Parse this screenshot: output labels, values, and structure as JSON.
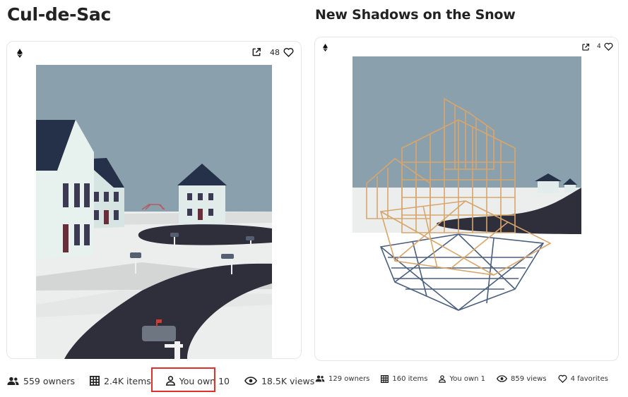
{
  "items": [
    {
      "title": "Cul-de-Sac",
      "favorites_count": "48",
      "artwork": "cul-de-sac-house-scene",
      "stats": {
        "owners": "559 owners",
        "items": "2.4K items",
        "you_own": "You own 10",
        "views": "18.5K views"
      }
    },
    {
      "title": "New Shadows on the Snow",
      "favorites_count": "4",
      "artwork": "wireframe-houses-scene",
      "stats": {
        "owners": "129 owners",
        "items": "160 items",
        "you_own": "You own 1",
        "views": "859 views",
        "favorites": "4 favorites"
      }
    }
  ],
  "icons": {
    "chain": "ethereum-icon",
    "open": "external-link-icon",
    "favorite": "heart-icon",
    "owners": "people-icon",
    "items": "grid-icon",
    "you_own": "person-icon",
    "views": "eye-icon",
    "favorites": "heart-icon"
  },
  "highlight_color": "#e0302a",
  "sky_color": "#8aa1ad"
}
